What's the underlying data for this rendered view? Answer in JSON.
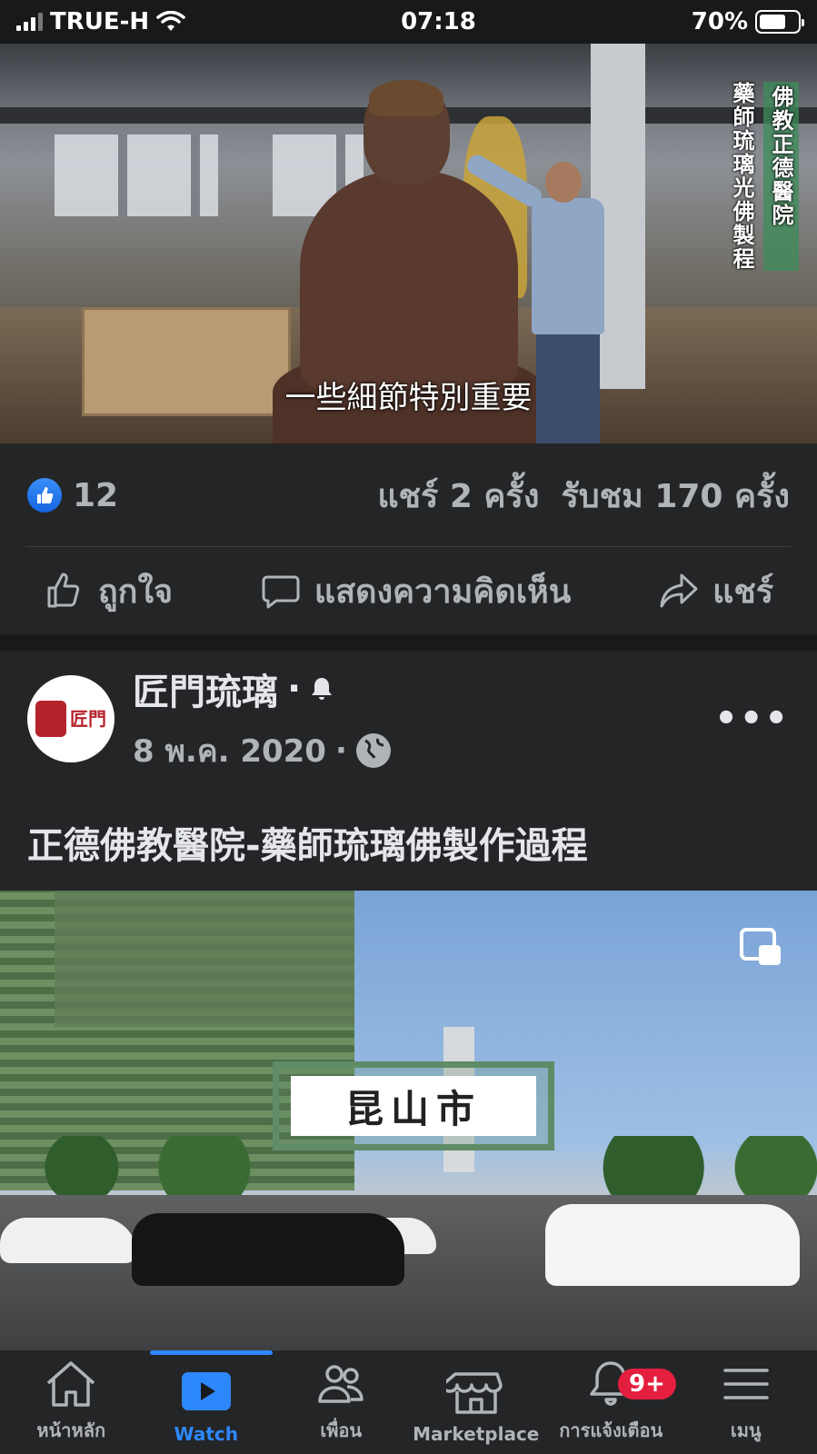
{
  "status_bar": {
    "carrier": "TRUE-H",
    "time": "07:18",
    "battery": "70%"
  },
  "post1": {
    "video": {
      "caption": "一些細節特別重要",
      "vertical_caption_col1": "佛教正德醫院",
      "vertical_caption_col2": "藥師琉璃光佛製程"
    },
    "like_count": "12",
    "shares": "แชร์ 2 ครั้ง",
    "views": "รับชม 170 ครั้ง",
    "actions": {
      "like": "ถูกใจ",
      "comment": "แสดงความคิดเห็น",
      "share": "แชร์"
    }
  },
  "post2": {
    "page_name": "匠門琉璃",
    "avatar_text": "匠門",
    "date": "8 พ.ค. 2020",
    "text": "正德佛教醫院-藥師琉璃佛製作過程",
    "video": {
      "sign_text": "昆山市"
    }
  },
  "tabbar": {
    "home": "หน้าหลัก",
    "watch": "Watch",
    "friends": "เพื่อน",
    "marketplace": "Marketplace",
    "notifications": "การแจ้งเตือน",
    "notifications_badge": "9+",
    "menu": "เมนู"
  },
  "colors": {
    "accent": "#2d88ff",
    "background": "#242526",
    "badge": "#e41e3f"
  }
}
